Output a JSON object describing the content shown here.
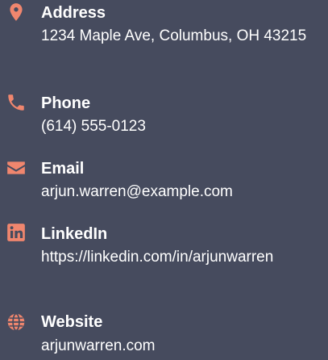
{
  "accent_color": "#f0866e",
  "contacts": [
    {
      "icon": "map-pin-icon",
      "title": "Address",
      "value": "1234 Maple Ave, Columbus, OH 43215"
    },
    {
      "icon": "phone-icon",
      "title": "Phone",
      "value": "(614) 555-0123"
    },
    {
      "icon": "envelope-icon",
      "title": "Email",
      "value": "arjun.warren@example.com"
    },
    {
      "icon": "linkedin-icon",
      "title": "LinkedIn",
      "value": "https://linkedin.com/in/arjunwarren"
    },
    {
      "icon": "globe-icon",
      "title": "Website",
      "value": "arjunwarren.com"
    }
  ]
}
